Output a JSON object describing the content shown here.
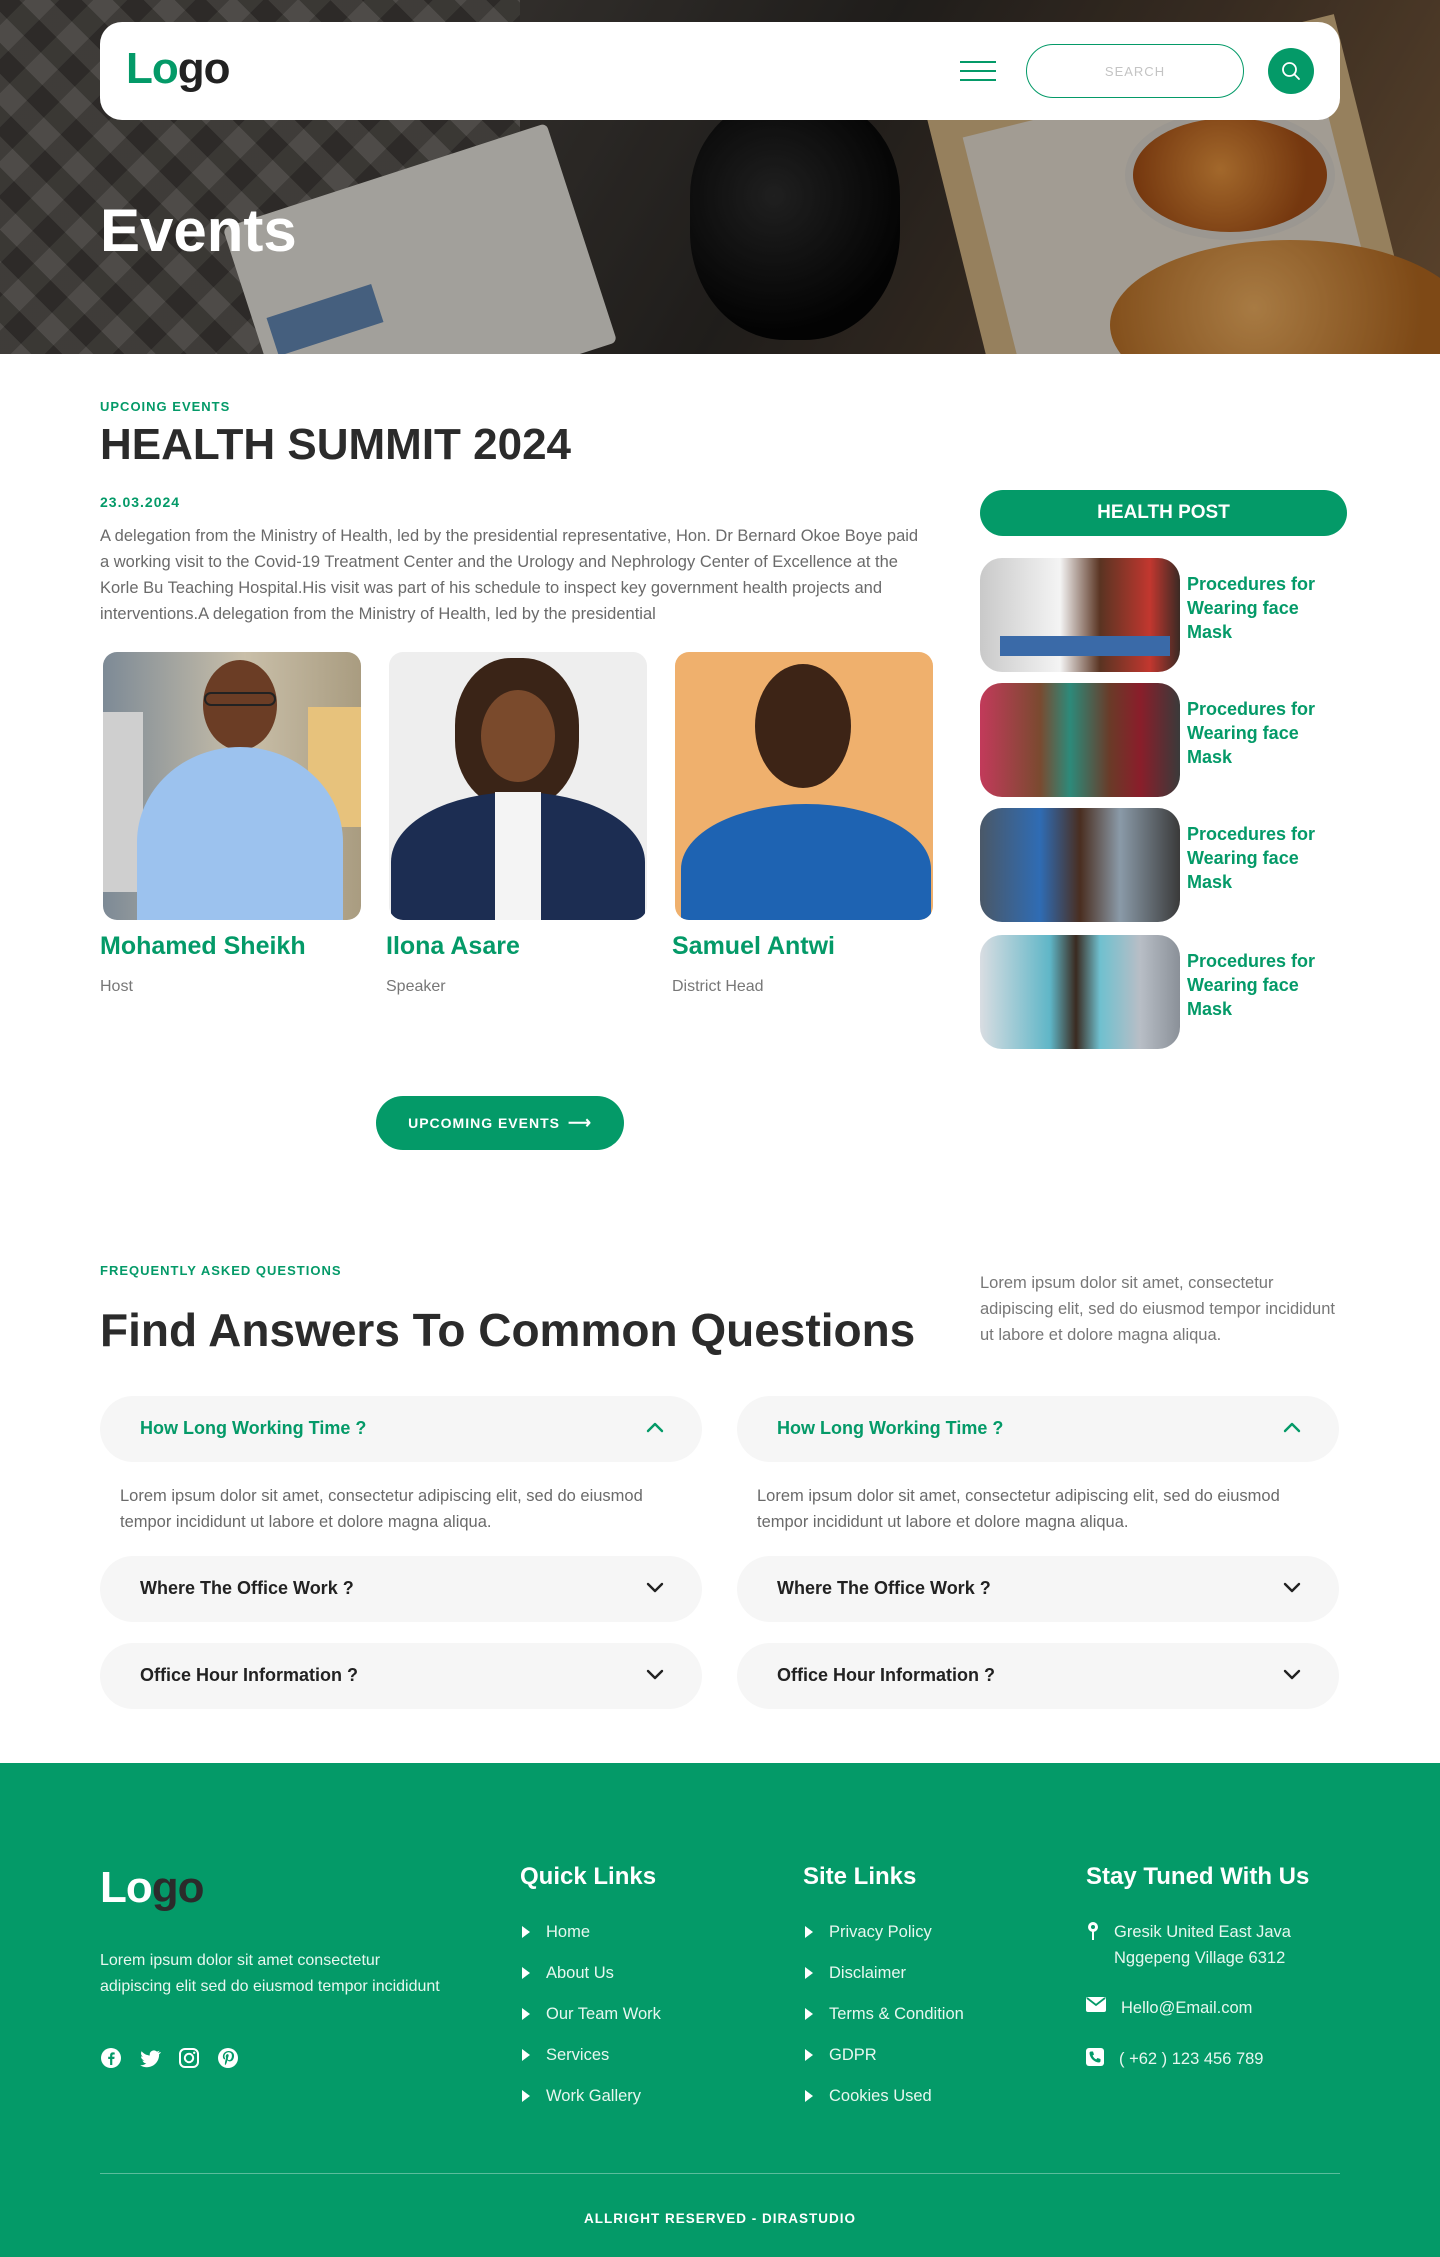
{
  "brand": {
    "logo_part1": "Lo",
    "logo_part2": "go",
    "accent": "#049a68"
  },
  "header": {
    "search_placeholder": "SEARCH"
  },
  "hero": {
    "title": "Events"
  },
  "event": {
    "kicker": "UPCOING EVENTS",
    "title": "HEALTH SUMMIT 2024",
    "date": "23.03.2024",
    "description": "A delegation from the Ministry of Health, led by the presidential representative, Hon. Dr Bernard Okoe Boye paid a working visit to the Covid-19 Treatment Center and the Urology and Nephrology Center of Excellence at the Korle Bu Teaching Hospital.His visit was part of his schedule to inspect key government health projects and interventions.A delegation from the Ministry of Health, led by the presidential",
    "people": [
      {
        "name": "Mohamed Sheikh",
        "role": "Host"
      },
      {
        "name": "Ilona Asare",
        "role": "Speaker"
      },
      {
        "name": "Samuel Antwi",
        "role": "District Head"
      }
    ],
    "button_label": "UPCOMING EVENTS"
  },
  "health_post": {
    "header": "HEALTH POST",
    "posts": [
      {
        "title": "Procedures for Wearing face Mask"
      },
      {
        "title": "Procedures for Wearing face Mask"
      },
      {
        "title": "Procedures for Wearing face Mask"
      },
      {
        "title": "Procedures for Wearing face Mask"
      }
    ]
  },
  "faq": {
    "kicker": "FREQUENTLY ASKED QUESTIONS",
    "title": "Find Answers To Common Questions",
    "intro": "Lorem ipsum dolor sit amet, consectetur adipiscing elit, sed do eiusmod tempor incididunt ut labore et dolore magna aliqua.",
    "columns": [
      {
        "items": [
          {
            "question": "How Long Working Time ?",
            "answer": "Lorem ipsum dolor sit amet, consectetur adipiscing elit, sed do eiusmod tempor incididunt ut labore et dolore magna aliqua.",
            "open": true
          },
          {
            "question": "Where The Office Work ?",
            "open": false
          },
          {
            "question": "Office Hour Information ?",
            "open": false
          }
        ]
      },
      {
        "items": [
          {
            "question": "How Long Working Time ?",
            "answer": "Lorem ipsum dolor sit amet, consectetur adipiscing elit, sed do eiusmod tempor incididunt ut labore et dolore magna aliqua.",
            "open": true
          },
          {
            "question": "Where The Office Work ?",
            "open": false
          },
          {
            "question": "Office Hour Information ?",
            "open": false
          }
        ]
      }
    ]
  },
  "footer": {
    "description": "Lorem ipsum dolor sit amet consectetur adipiscing elit sed do eiusmod tempor incididunt",
    "social_icons": [
      "facebook-icon",
      "twitter-icon",
      "instagram-icon",
      "pinterest-icon"
    ],
    "quick_links": {
      "title": "Quick Links",
      "items": [
        "Home",
        "About Us",
        "Our Team Work",
        "Services",
        "Work Gallery"
      ]
    },
    "site_links": {
      "title": "Site Links",
      "items": [
        "Privacy Policy",
        "Disclaimer",
        "Terms & Condition",
        "GDPR",
        "Cookies Used"
      ]
    },
    "contact": {
      "title": "Stay Tuned With Us",
      "address_line1": "Gresik United East Java",
      "address_line2": "Nggepeng Village 6312",
      "email": "Hello@Email.com",
      "phone": "( +62 ) 123 456 789"
    },
    "copyright": "ALLRIGHT RESERVED - DIRASTUDIO"
  }
}
